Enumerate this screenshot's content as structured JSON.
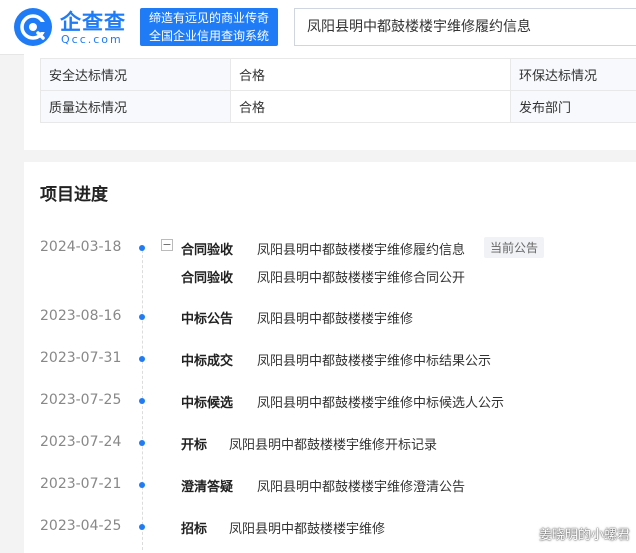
{
  "header": {
    "logo_name": "企查查",
    "logo_domain": "Qcc.com",
    "slogan_line1": "缔造有远见的商业传奇",
    "slogan_line2": "全国企业信用查询系统",
    "search_value": "凤阳县明中都鼓楼楼宇维修履约信息",
    "brand_color": "#1f7cf6"
  },
  "info_table": {
    "rows": [
      {
        "label": "安全达标情况",
        "value": "合格",
        "label2": "环保达标情况"
      },
      {
        "label": "质量达标情况",
        "value": "合格",
        "label2": "发布部门"
      }
    ]
  },
  "progress": {
    "section_title": "项目进度",
    "items": [
      {
        "date": "2024-03-18",
        "stage": "合同验收",
        "title": "凤阳县明中都鼓楼楼宇维修履约信息",
        "badge": "当前公告",
        "expand_symbol": "−"
      },
      {
        "date": "",
        "stage": "合同验收",
        "title": "凤阳县明中都鼓楼楼宇维修合同公开"
      },
      {
        "date": "2023-08-16",
        "stage": "中标公告",
        "title": "凤阳县明中都鼓楼楼宇维修"
      },
      {
        "date": "2023-07-31",
        "stage": "中标成交",
        "title": "凤阳县明中都鼓楼楼宇维修中标结果公示"
      },
      {
        "date": "2023-07-25",
        "stage": "中标候选",
        "title": "凤阳县明中都鼓楼楼宇维修中标候选人公示"
      },
      {
        "date": "2023-07-24",
        "stage": "开标",
        "title": "凤阳县明中都鼓楼楼宇维修开标记录"
      },
      {
        "date": "2023-07-21",
        "stage": "澄清答疑",
        "title": "凤阳县明中都鼓楼楼宇维修澄清公告"
      },
      {
        "date": "2023-04-25",
        "stage": "招标",
        "title": "凤阳县明中都鼓楼楼宇维修"
      }
    ]
  },
  "watermark": "姜晓明的小螺君"
}
